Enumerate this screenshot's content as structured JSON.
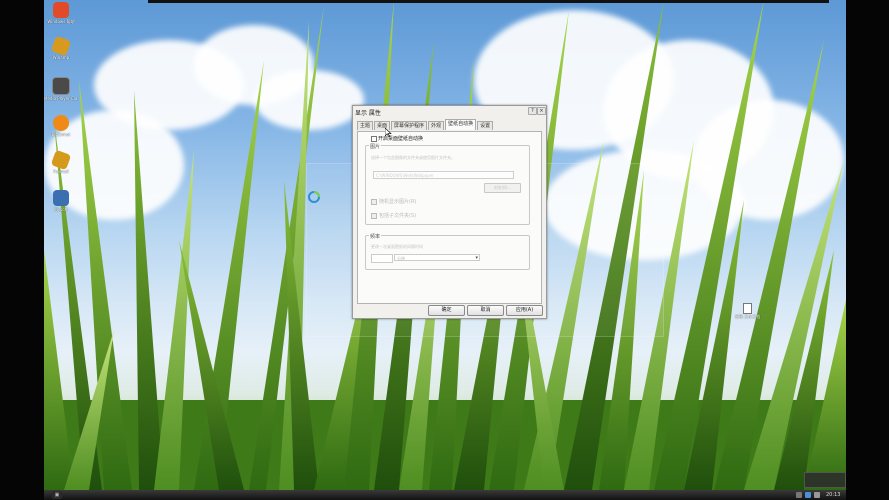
{
  "desktop_icons": [
    {
      "label": "Windows 帮助",
      "icon": "windows-help-icon",
      "color": "#e24b2a"
    },
    {
      "label": "Winamp",
      "icon": "winamp-icon",
      "color": "#d89a1e"
    },
    {
      "label": "Media Player Classic",
      "icon": "media-player-icon",
      "color": "#4a4a4a"
    },
    {
      "label": "BitComet",
      "icon": "bitcomet-icon",
      "color": "#f08a16"
    },
    {
      "label": "Foxmail",
      "icon": "foxmail-icon",
      "color": "#d59a1c"
    },
    {
      "label": "Mysoft",
      "icon": "mysoft-icon",
      "color": "#3b6fb0"
    }
  ],
  "dialog": {
    "title": "显示 属性",
    "help_button": "?",
    "close_button": "×",
    "tabs": [
      "主题",
      "桌面",
      "屏幕保护程序",
      "外观",
      "壁纸自动换",
      "设置"
    ],
    "active_tab_index": 4,
    "enable_label": "开启桌面壁纸自动换",
    "image_group": {
      "title": "图片",
      "hint": "选择一个包含图像的文件夹或使用图片文件夹。",
      "path_value": "C:\\WINDOWS\\Web\\Wallpaper",
      "browse_button": "浏览(B)...",
      "checkbox_random": "随机显示图片(R)",
      "checkbox_subfolders": "包括子文件夹(S)"
    },
    "freq_group": {
      "title": "频率",
      "hint": "更改一次桌面壁纸的间隔时间",
      "unit_value": "分钟"
    },
    "buttons": {
      "ok": "确定",
      "cancel": "取消",
      "apply": "应用(A)"
    }
  },
  "desktop_file": {
    "label": "新建 文本文档",
    "icon": "text-file-icon"
  },
  "taskbar": {
    "start_label": "开始",
    "clock": "20:13"
  },
  "colors": {
    "dialog_bg": "#f1f0ec",
    "taskbar": "#1c1c1c",
    "sky": "#86b6e6"
  }
}
